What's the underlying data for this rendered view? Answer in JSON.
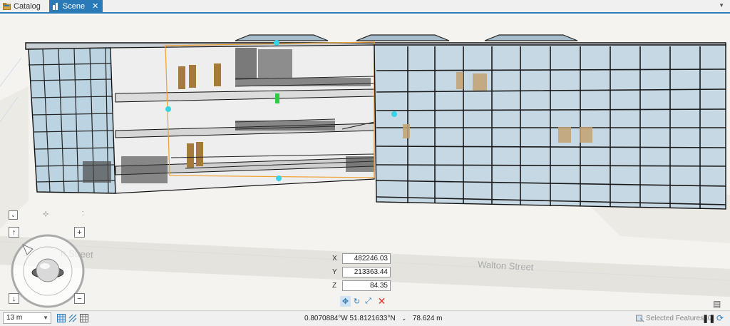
{
  "tabs": [
    {
      "label": "Catalog",
      "active": false
    },
    {
      "label": "Scene",
      "active": true
    }
  ],
  "coordinates": {
    "x_label": "X",
    "x_value": "482246.03",
    "y_label": "Y",
    "y_value": "213363.44",
    "z_label": "Z",
    "z_value": "84.35"
  },
  "street_labels": [
    "n Street",
    "Walton Street"
  ],
  "status": {
    "scale": "13 m",
    "location": "0.8070884°W 51.8121633°N",
    "elevation": "78.624 m",
    "selected_features": "Selected Features: 0"
  },
  "colors": {
    "accent": "#2a7ab8",
    "handle": "#39d3e6",
    "gizmo": "#2ecc40",
    "cancel": "#d9342b"
  }
}
